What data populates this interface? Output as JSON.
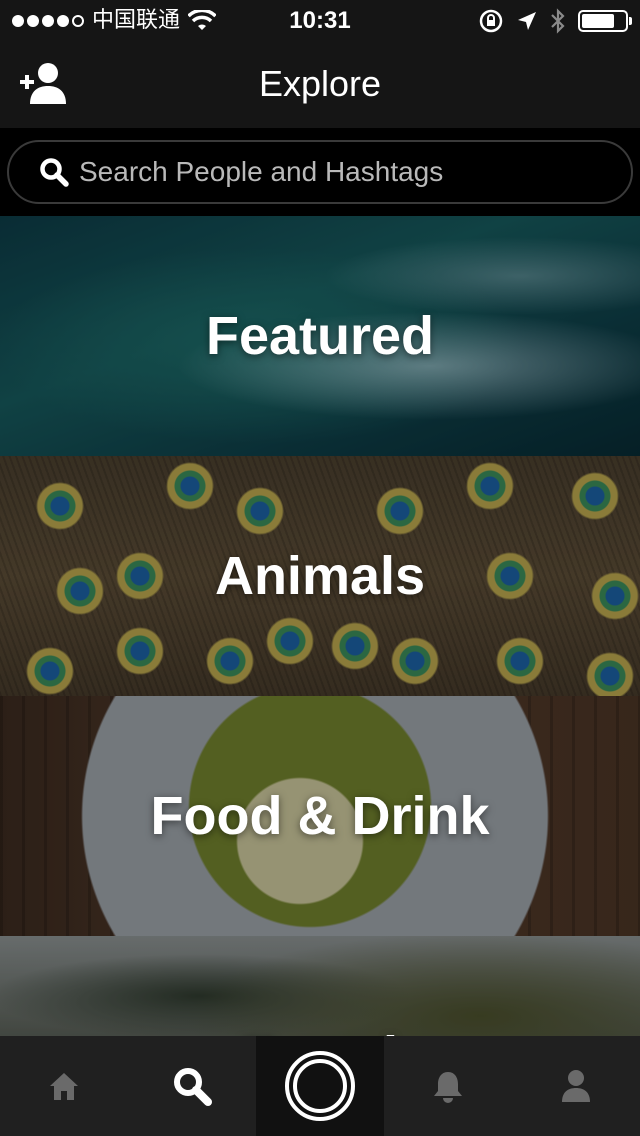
{
  "status_bar": {
    "carrier": "中国联通",
    "time": "10:31",
    "signal_bars_filled": 4,
    "signal_bars_total": 5,
    "battery_level": 0.75
  },
  "nav": {
    "title": "Explore",
    "add_user_icon": "add-person-icon"
  },
  "search": {
    "placeholder": "Search People and Hashtags",
    "value": ""
  },
  "categories": [
    {
      "label": "Featured",
      "image": "surf-wave"
    },
    {
      "label": "Animals",
      "image": "peacock-feathers"
    },
    {
      "label": "Food & Drink",
      "image": "plated-couscous"
    },
    {
      "label": "Travel",
      "image": "rocky-coast"
    }
  ],
  "tab_bar": {
    "items": [
      {
        "icon": "home-icon",
        "active": false
      },
      {
        "icon": "search-icon",
        "active": true
      },
      {
        "icon": "capture-icon",
        "active": false
      },
      {
        "icon": "bell-icon",
        "active": false
      },
      {
        "icon": "profile-icon",
        "active": false
      }
    ],
    "colors": {
      "active": "#ffffff",
      "inactive": "#6a6a6a"
    }
  }
}
